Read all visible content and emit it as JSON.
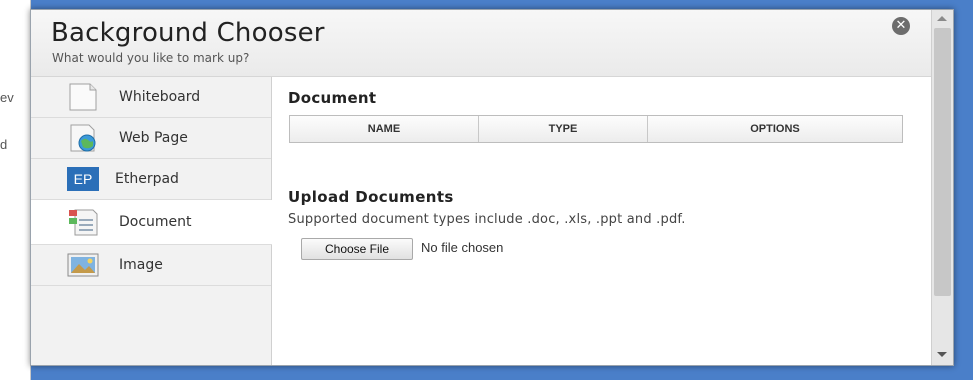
{
  "background": {
    "snippets": [
      "ev",
      "d"
    ]
  },
  "dialog": {
    "title": "Background Chooser",
    "subtitle": "What would you like to mark up?",
    "close_icon": "close-icon"
  },
  "sidebar": {
    "items": [
      {
        "label": "Whiteboard",
        "icon": "blank-page-icon"
      },
      {
        "label": "Web Page",
        "icon": "web-page-globe-icon"
      },
      {
        "label": "Etherpad",
        "icon": "etherpad-icon",
        "icon_text": "EP"
      },
      {
        "label": "Document",
        "icon": "document-icon",
        "active": true
      },
      {
        "label": "Image",
        "icon": "image-icon"
      }
    ]
  },
  "main": {
    "section_title": "Document",
    "table": {
      "columns": [
        "NAME",
        "TYPE",
        "OPTIONS"
      ]
    },
    "upload": {
      "title": "Upload Documents",
      "description": "Supported document types include .doc, .xls, .ppt and .pdf.",
      "button_label": "Choose File",
      "status": "No file chosen"
    }
  },
  "colors": {
    "frame_blue": "#4a7fc9",
    "etherpad_blue": "#2b6fb8"
  }
}
